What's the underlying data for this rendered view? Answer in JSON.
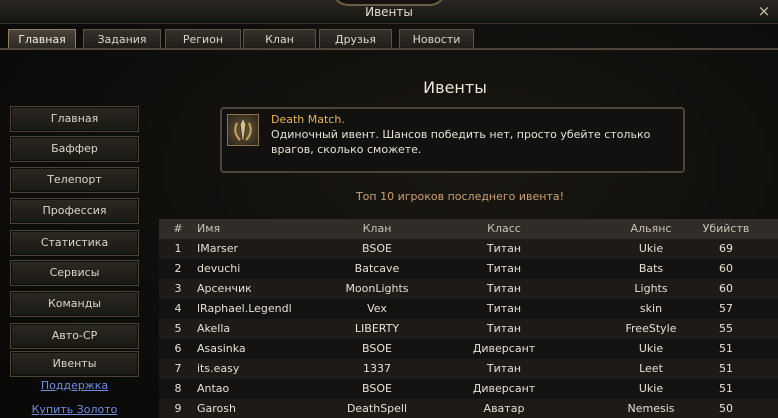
{
  "window": {
    "title": "Ивенты",
    "close_icon": "×"
  },
  "tabs": [
    {
      "label": "Главная",
      "active": true
    },
    {
      "label": "Задания"
    },
    {
      "label": "Регион"
    },
    {
      "label": "Клан"
    },
    {
      "label": "Друзья"
    },
    {
      "label": "Новости"
    }
  ],
  "sidebar": {
    "buttons": [
      "Главная",
      "Баффер",
      "Телепорт",
      "Профессия",
      "Статистика",
      "Сервисы",
      "Команды",
      "Авто-CP",
      "Ивенты"
    ],
    "links": [
      "Поддержка",
      "Купить Золото"
    ]
  },
  "main": {
    "heading": "Ивенты",
    "event": {
      "icon": "sword-icon",
      "title": "Death Match.",
      "description": " Одиночный ивент. Шансов победить нет, просто убейте столько врагов, сколько сможете."
    },
    "subtitle": "Топ 10 игроков последнего ивента!",
    "table": {
      "headers": [
        "#",
        "Имя",
        "Клан",
        "Класс",
        "Альянс",
        "Убийств"
      ],
      "rows": [
        [
          "1",
          "IMarser",
          "BSOE",
          "Титан",
          "Ukie",
          "69"
        ],
        [
          "2",
          "devuchi",
          "Batcave",
          "Титан",
          "Bats",
          "60"
        ],
        [
          "3",
          "Арсенчик",
          "MoonLights",
          "Титан",
          "Lights",
          "60"
        ],
        [
          "4",
          "lRaphael.Legendl",
          "Vex",
          "Титан",
          "skin",
          "57"
        ],
        [
          "5",
          "Akella",
          "LIBERTY",
          "Титан",
          "FreeStyle",
          "55"
        ],
        [
          "6",
          "Asasinka",
          "BSOE",
          "Диверсант",
          "Ukie",
          "51"
        ],
        [
          "7",
          "its.easy",
          "1337",
          "Титан",
          "Leet",
          "51"
        ],
        [
          "8",
          "Antao",
          "BSOE",
          "Диверсант",
          "Ukie",
          "51"
        ],
        [
          "9",
          "Garosh",
          "DeathSpell",
          "Аватар",
          "Nemesis",
          "50"
        ]
      ]
    }
  }
}
